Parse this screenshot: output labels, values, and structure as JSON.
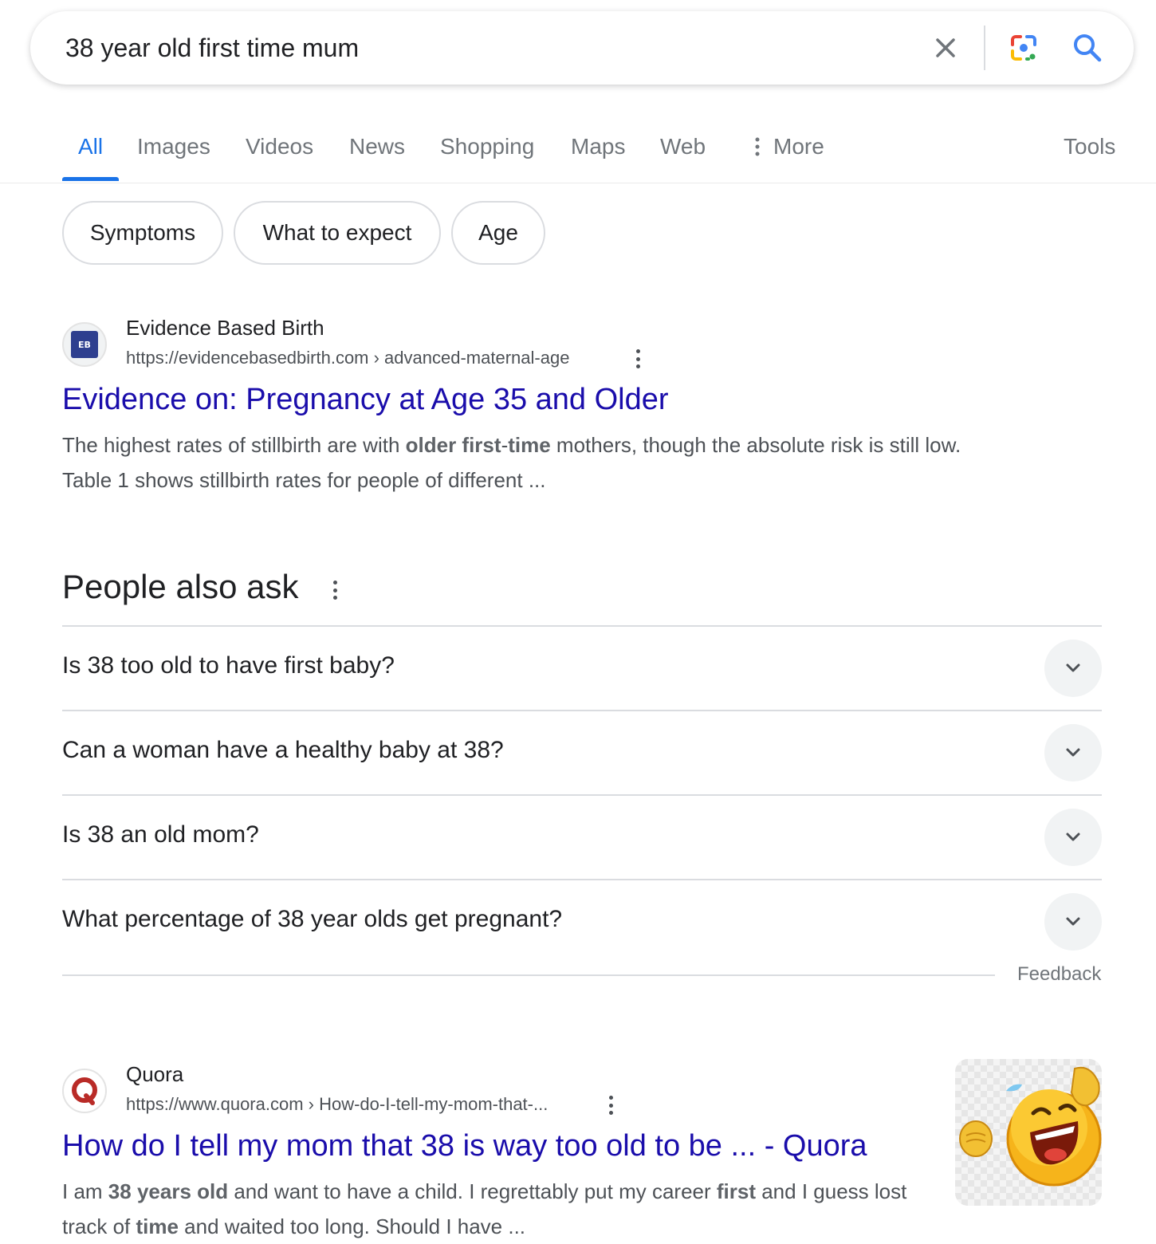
{
  "search": {
    "query": "38 year old first time mum"
  },
  "tabs": {
    "items": [
      {
        "label": "All",
        "active": true
      },
      {
        "label": "Images"
      },
      {
        "label": "Videos"
      },
      {
        "label": "News"
      },
      {
        "label": "Shopping"
      },
      {
        "label": "Maps"
      },
      {
        "label": "Web"
      },
      {
        "label": "More"
      }
    ],
    "tools_label": "Tools"
  },
  "chips": [
    {
      "label": "Symptoms"
    },
    {
      "label": "What to expect"
    },
    {
      "label": "Age"
    }
  ],
  "results": [
    {
      "site_name": "Evidence Based Birth",
      "favicon_text": "EB",
      "url": "https://evidencebasedbirth.com › advanced-maternal-age",
      "title": "Evidence on: Pregnancy at Age 35 and Older",
      "snippet": [
        {
          "t": "The highest rates of stillbirth are with "
        },
        {
          "t": "older first",
          "b": true
        },
        {
          "t": "-"
        },
        {
          "t": "time",
          "b": true
        },
        {
          "t": " mothers, though the absolute risk is still low. Table 1 shows stillbirth rates for people of different ..."
        }
      ]
    },
    {
      "site_name": "Quora",
      "url": "https://www.quora.com › How-do-I-tell-my-mom-that-...",
      "title": "How do I tell my mom that 38 is way too old to be ... - Quora",
      "snippet": [
        {
          "t": "I am "
        },
        {
          "t": "38 years old",
          "b": true
        },
        {
          "t": " and want to have a child. I regrettably put my career "
        },
        {
          "t": "first",
          "b": true
        },
        {
          "t": " and I guess lost track of "
        },
        {
          "t": "time",
          "b": true
        },
        {
          "t": " and waited too long. Should I have ..."
        }
      ]
    }
  ],
  "people_also_ask": {
    "heading": "People also ask",
    "questions": [
      "Is 38 too old to have first baby?",
      "Can a woman have a healthy baby at 38?",
      "Is 38 an old mom?",
      "What percentage of 38 year olds get pregnant?"
    ],
    "feedback_label": "Feedback"
  },
  "colors": {
    "link": "#1a0dab",
    "accent": "#1a73e8",
    "muted": "#70757a"
  },
  "icons": [
    "close-icon",
    "google-lens-icon",
    "search-icon",
    "more-vert-icon",
    "chevron-down-icon"
  ]
}
